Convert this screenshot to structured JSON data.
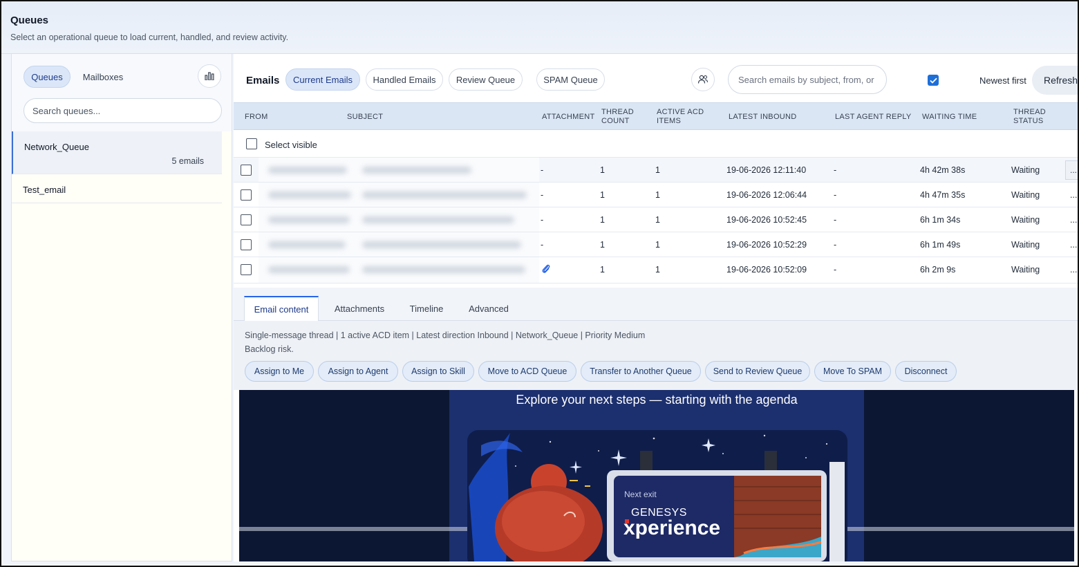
{
  "page": {
    "title": "Queues",
    "subtitle": "Select an operational queue to load current, handled, and review activity."
  },
  "sidebar": {
    "tabs": [
      {
        "label": "Queues"
      },
      {
        "label": "Mailboxes"
      }
    ],
    "stats_icon": "bar-chart-icon",
    "search_placeholder": "Search queues...",
    "queues": [
      {
        "name": "Network_Queue",
        "count": "5 emails"
      },
      {
        "name": "Test_email",
        "count": ""
      }
    ]
  },
  "toolbar": {
    "title": "Emails",
    "tabs": [
      {
        "label": "Current Emails"
      },
      {
        "label": "Handled Emails"
      },
      {
        "label": "Review Queue"
      },
      {
        "label": "SPAM Queue"
      }
    ],
    "assign_icon": "user-group-icon",
    "search_placeholder": "Search emails by subject, from, or",
    "newest_first_checked": true,
    "newest_first_label": "Newest first",
    "refresh_label": "Refresh"
  },
  "table": {
    "headers": [
      "FROM",
      "SUBJECT",
      "ATTACHMENT",
      "THREAD COUNT",
      "ACTIVE ACD ITEMS",
      "LATEST INBOUND",
      "LAST AGENT REPLY",
      "WAITING TIME",
      "THREAD STATUS"
    ],
    "select_visible_label": "Select visible",
    "rows": [
      {
        "attachment": "-",
        "thread_count": "1",
        "active_acd": "1",
        "latest_inbound": "19-06-2026 12:11:40",
        "last_reply": "-",
        "waiting": "4h 42m 38s",
        "status": "Waiting",
        "more": "..."
      },
      {
        "attachment": "-",
        "thread_count": "1",
        "active_acd": "1",
        "latest_inbound": "19-06-2026 12:06:44",
        "last_reply": "-",
        "waiting": "4h 47m 35s",
        "status": "Waiting",
        "more": "..."
      },
      {
        "attachment": "-",
        "thread_count": "1",
        "active_acd": "1",
        "latest_inbound": "19-06-2026 10:52:45",
        "last_reply": "-",
        "waiting": "6h 1m 34s",
        "status": "Waiting",
        "more": "..."
      },
      {
        "attachment": "-",
        "thread_count": "1",
        "active_acd": "1",
        "latest_inbound": "19-06-2026 10:52:29",
        "last_reply": "-",
        "waiting": "6h 1m 49s",
        "status": "Waiting",
        "more": "..."
      },
      {
        "attachment": "paperclip-icon",
        "thread_count": "1",
        "active_acd": "1",
        "latest_inbound": "19-06-2026 10:52:09",
        "last_reply": "-",
        "waiting": "6h 2m 9s",
        "status": "Waiting",
        "more": "..."
      }
    ]
  },
  "detail": {
    "tabs": [
      {
        "label": "Email content"
      },
      {
        "label": "Attachments"
      },
      {
        "label": "Timeline"
      },
      {
        "label": "Advanced"
      }
    ],
    "meta_line": "Single-message thread | 1 active ACD item | Latest direction Inbound | Network_Queue | Priority Medium",
    "risk_line": "Backlog risk.",
    "actions": [
      {
        "label": "Assign to Me"
      },
      {
        "label": "Assign to Agent"
      },
      {
        "label": "Assign to Skill"
      },
      {
        "label": "Move to ACD Queue"
      },
      {
        "label": "Transfer to Another Queue"
      },
      {
        "label": "Send to Review Queue"
      },
      {
        "label": "Move To SPAM"
      },
      {
        "label": "Disconnect"
      }
    ]
  },
  "email_preview": {
    "headline": "Explore your next steps — starting with the agenda",
    "billboard_small": "Next exit",
    "brand": "GENESYS",
    "product": "xperience",
    "colors": {
      "background": "#0c1734",
      "banner": "#1c2f6e",
      "accent": "#e2362c"
    }
  }
}
